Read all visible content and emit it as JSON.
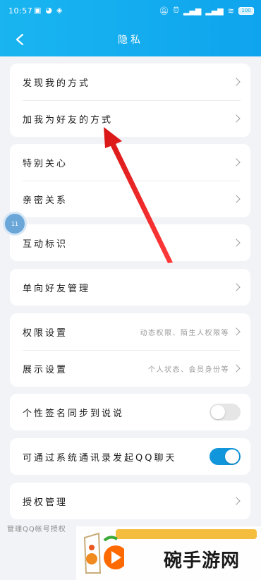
{
  "status_bar": {
    "time": "10:57",
    "left_icons": [
      "notification-icon",
      "cat-icon",
      "shield-icon"
    ],
    "right_icons": [
      "mute-icon",
      "alarm-icon",
      "hd-signal-icon",
      "hd-signal-icon",
      "wifi-icon"
    ],
    "battery": "100"
  },
  "header": {
    "title": "隐私"
  },
  "sections": [
    {
      "rows": [
        {
          "label": "发现我的方式"
        },
        {
          "label": "加我为好友的方式"
        }
      ]
    },
    {
      "rows": [
        {
          "label": "特别关心"
        },
        {
          "label": "亲密关系"
        }
      ]
    },
    {
      "rows": [
        {
          "label": "互动标识"
        }
      ]
    },
    {
      "rows": [
        {
          "label": "单向好友管理"
        }
      ]
    },
    {
      "rows": [
        {
          "label": "权限设置",
          "hint": "动态权限、陌生人权限等"
        },
        {
          "label": "展示设置",
          "hint": "个人状态、会员身份等"
        }
      ]
    },
    {
      "rows": [
        {
          "label": "个性签名同步到说说",
          "toggle": "off"
        }
      ]
    },
    {
      "rows": [
        {
          "label": "可通过系统通讯录发起QQ聊天",
          "toggle": "on"
        }
      ]
    },
    {
      "rows": [
        {
          "label": "授权管理"
        }
      ]
    }
  ],
  "footnote": "管理QQ帐号授权",
  "floating_bubble": {
    "text": "11"
  },
  "watermark": {
    "text": "碗手游网"
  },
  "colors": {
    "header": "#12a9ee",
    "toggle_on": "#1296db",
    "arrow": "#e02020"
  }
}
